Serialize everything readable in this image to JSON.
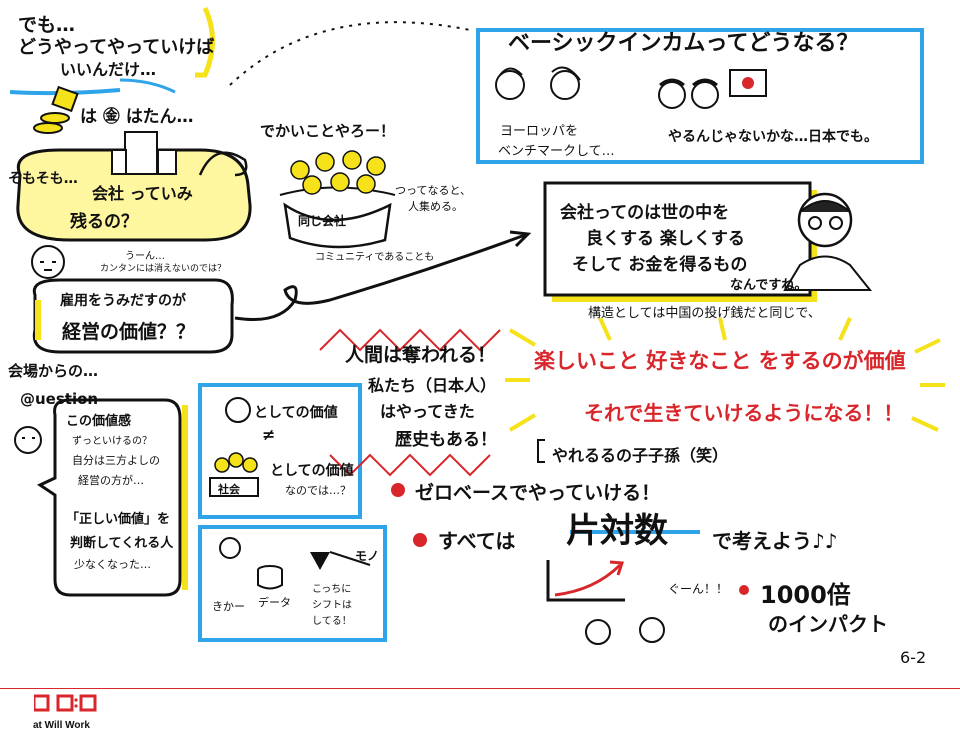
{
  "colors": {
    "red": "#d8262b",
    "blue": "#2fa4e8",
    "yellow": "#f5e21a",
    "ink": "#111111"
  },
  "top_left": {
    "line1": "でも…",
    "line2": "どうやってやっていけば",
    "line3": "いいんだけ…"
  },
  "coin_note": "は ㊎ はたん…",
  "speech1": {
    "prefix": "そもそも…",
    "main": "会社 っていみ",
    "tail": "残るの？"
  },
  "tiny_note1": {
    "line1": "うーん…",
    "line2": "カンタンには消えないのでは？"
  },
  "cake": {
    "title": "でかいことやろー！",
    "label": "同じ会社",
    "side1": "つってなると、",
    "side2": "人集める。",
    "bottom": "コミュニティであることも"
  },
  "basic_income": {
    "title": "ベーシックインカムってどうなる？",
    "left": "ヨーロッパを",
    "left2": "ベンチマークして…",
    "right": "やるんじゃないかな…日本でも。"
  },
  "quote": {
    "line1": "会社ってのは世の中を",
    "line2": "良くする 楽しくする",
    "line3": "そして お金を得るもの",
    "line4": "なんですね。"
  },
  "structure_note": "構造としては中国の投げ銭だと同じで、",
  "employ": {
    "line1": "雇用をうみだすのが",
    "line2": "経営の価値？？"
  },
  "hall": {
    "line1": "会場からの…",
    "line2": "@uestion"
  },
  "question_box": {
    "l1": "この価値感",
    "l2": "ずっといけるの？",
    "l3": "自分は三方よしの",
    "l4": "経営の方が…",
    "l5": "「正しい価値」を",
    "l6": "判断してくれる人",
    "l7": "少なくなった…"
  },
  "value_box": {
    "row1": "としての価値",
    "neq": "≠",
    "row2a": "としての価値",
    "row2b": "なのでは…？",
    "badge": "社会"
  },
  "shift_box": {
    "mo": "モノ",
    "data": "データ",
    "left": "きかー",
    "shift1": "こっちに",
    "shift2": "シフトは",
    "shift3": "してる！"
  },
  "people": {
    "line1": "人間は奪われる！",
    "line2": "私たち（日本人）",
    "line3": "はやってきた",
    "line4": "歴史もある！"
  },
  "value_red": {
    "line1": "楽しいこと 好きなこと をするのが価値",
    "line2": "それで生きていけるようになる！！"
  },
  "can_do": "やれるるの子子孫（笑）",
  "bullet1": "ゼロベースでやっていける！",
  "bullet2": {
    "prefix": "すべては",
    "big": "片対数",
    "suffix": "で考えよう♪♪"
  },
  "gun": "ぐーん！！",
  "impact": {
    "line1": "1000倍",
    "line2": "のインパクト"
  },
  "page_num": "6-2",
  "logo_text": "at Will Work"
}
